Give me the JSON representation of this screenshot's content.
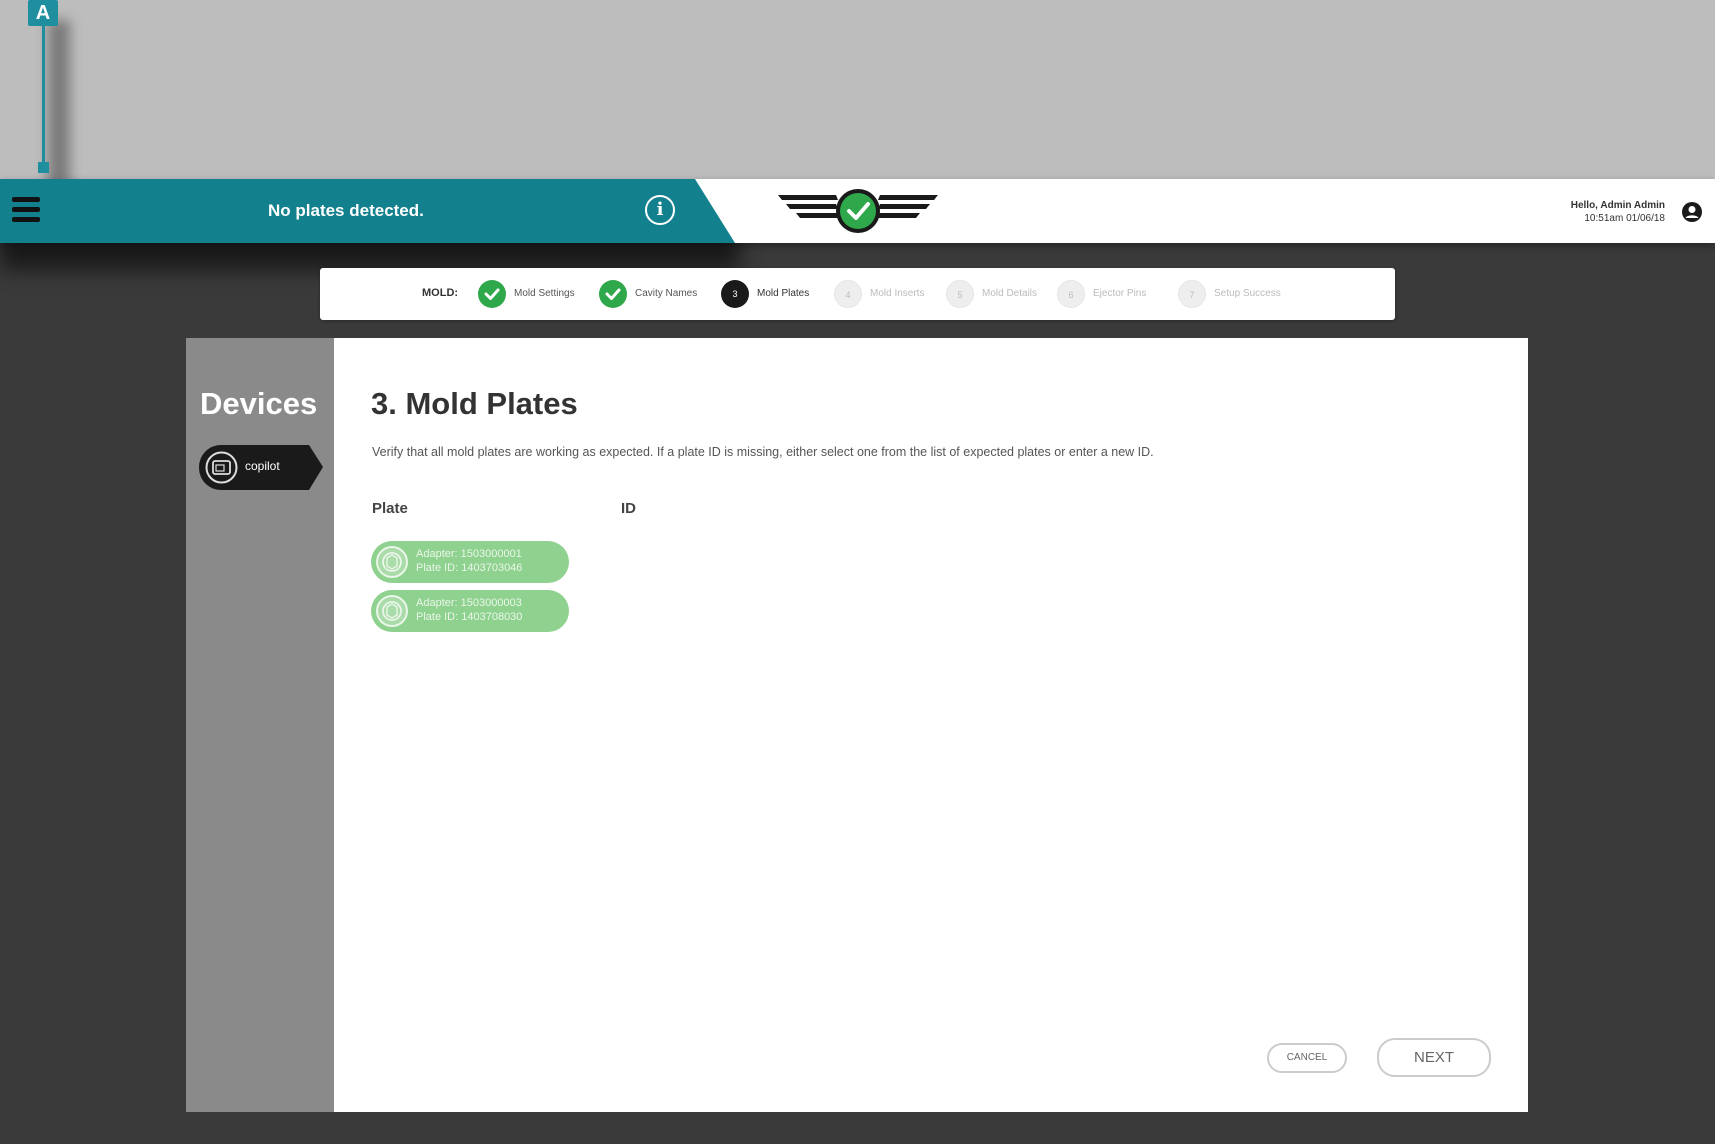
{
  "callout": {
    "label": "A"
  },
  "header": {
    "menu_icon": "hamburger-menu-icon",
    "banner_text": "No plates detected.",
    "info_icon": "info-icon",
    "user_greeting": "Hello, Admin Admin",
    "user_timestamp": "10:51am 01/06/18",
    "user_icon": "user-account-icon"
  },
  "stepper": {
    "prefix": "MOLD:",
    "steps": [
      {
        "marker": "",
        "label": "Mold Settings",
        "state": "done"
      },
      {
        "marker": "",
        "label": "Cavity Names",
        "state": "done"
      },
      {
        "marker": "3",
        "label": "Mold Plates",
        "state": "current"
      },
      {
        "marker": "4",
        "label": "Mold Inserts",
        "state": "todo"
      },
      {
        "marker": "5",
        "label": "Mold Details",
        "state": "todo"
      },
      {
        "marker": "6",
        "label": "Ejector Pins",
        "state": "todo"
      },
      {
        "marker": "7",
        "label": "Setup Success",
        "state": "todo"
      }
    ]
  },
  "sidebar": {
    "title": "Devices",
    "device": {
      "icon": "device-icon",
      "label": "copilot"
    }
  },
  "main": {
    "title": "3. Mold Plates",
    "description": "Verify that all mold plates are working as expected. If a plate ID is missing, either select one from the list of expected plates or enter a new ID.",
    "col_plate": "Plate",
    "col_id": "ID",
    "plates": [
      {
        "icon": "plate-icon",
        "adapter": "Adapter: 1503000001",
        "plate_id": "Plate ID: 1403703046"
      },
      {
        "icon": "plate-icon",
        "adapter": "Adapter: 1503000003",
        "plate_id": "Plate ID: 1403708030"
      }
    ]
  },
  "actions": {
    "cancel": "CANCEL",
    "next": "NEXT"
  },
  "colors": {
    "accent": "#13808e",
    "success": "#2ea84a",
    "plate": "#8fd18e"
  }
}
